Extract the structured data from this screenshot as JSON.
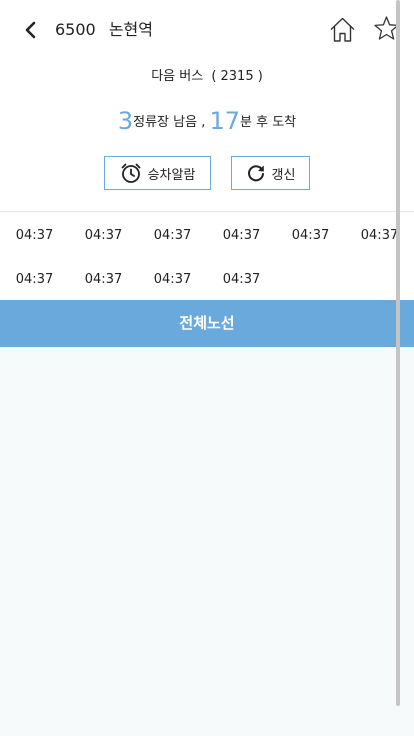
{
  "header": {
    "route_number": "6500",
    "stop_name": "논현역",
    "back_icon": "chevron-left-icon",
    "home_icon": "home-icon",
    "favorite_icon": "star-outline-icon"
  },
  "next_bus": {
    "label": "다음 버스",
    "plate_text": "( 2315 )"
  },
  "arrival": {
    "stops_left": "3",
    "stops_label": "정류장 남음 ,",
    "minutes": "17",
    "minutes_label": "분 후 도착"
  },
  "buttons": {
    "alarm_label": "승차알람",
    "refresh_label": "갱신",
    "alarm_icon": "alarm-clock-icon",
    "refresh_icon": "refresh-icon"
  },
  "departure_times": [
    "04:37",
    "04:37",
    "04:37",
    "04:37",
    "04:37",
    "04:37",
    "04:37",
    "04:37",
    "04:37",
    "04:37"
  ],
  "all_routes_label": "전체노선",
  "colors": {
    "accent": "#6aa9dc",
    "content_bg": "#f7fafb",
    "divider": "#e6e6e6"
  }
}
